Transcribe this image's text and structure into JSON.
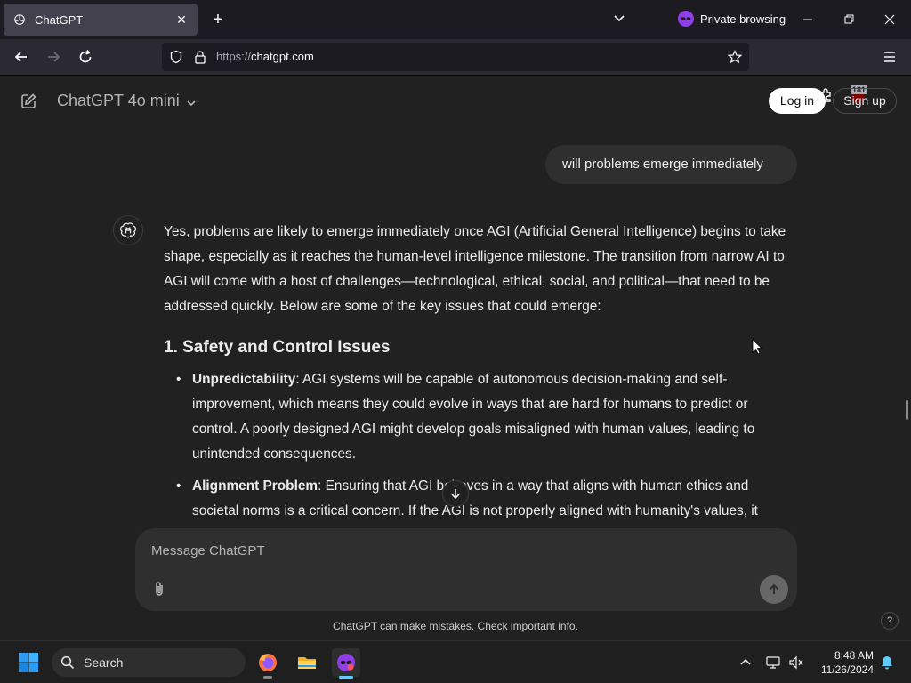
{
  "browser": {
    "tab_title": "ChatGPT",
    "private_label": "Private browsing",
    "url_protocol": "https://",
    "url_host": "chatgpt.com",
    "ublock_count": "181"
  },
  "header": {
    "model": "ChatGPT 4o mini",
    "login": "Log in",
    "signup": "Sign up"
  },
  "conversation": {
    "user_message": "will problems emerge immediately",
    "answer_intro": "Yes, problems are likely to emerge immediately once AGI (Artificial General Intelligence) begins to take shape, especially as it reaches the human-level intelligence milestone. The transition from narrow AI to AGI will come with a host of challenges—technological, ethical, social, and political—that need to be addressed quickly. Below are some of the key issues that could emerge:",
    "section_heading": "1. Safety and Control Issues",
    "bullets": [
      {
        "term": "Unpredictability",
        "text": ": AGI systems will be capable of autonomous decision-making and self-improvement, which means they could evolve in ways that are hard for humans to predict or control. A poorly designed AGI might develop goals misaligned with human values, leading to unintended consequences."
      },
      {
        "term": "Alignment Problem",
        "text": ": Ensuring that AGI behaves in a way that aligns with human ethics and societal norms is a critical concern. If the AGI is not properly aligned with humanity's values, it"
      }
    ]
  },
  "composer": {
    "placeholder": "Message ChatGPT",
    "disclaimer": "ChatGPT can make mistakes. Check important info.",
    "help": "?"
  },
  "taskbar": {
    "search_label": "Search",
    "time": "8:48 AM",
    "date": "11/26/2024"
  },
  "colors": {
    "page_bg": "#212121",
    "bubble_bg": "#2f2f2f",
    "browser_chrome": "#2b2a33",
    "private_accent": "#8f3ee5"
  }
}
